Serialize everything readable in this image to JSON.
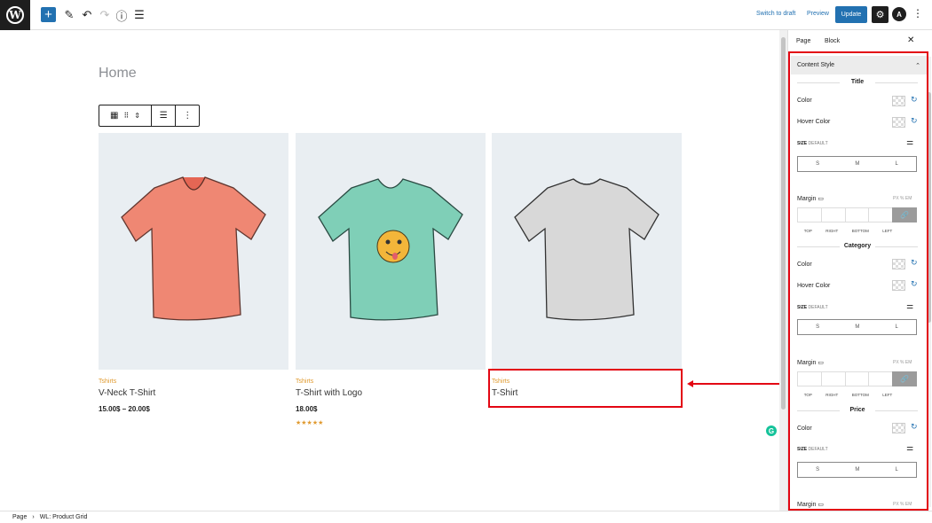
{
  "toolbar": {
    "switch_to_draft": "Switch to draft",
    "preview": "Preview",
    "update": "Update",
    "add_icon": "+",
    "edit_icon": "✎",
    "undo_icon": "↶",
    "redo_icon": "↷",
    "info_icon": "ⓘ",
    "list_icon": "☰",
    "settings_icon": "⚙",
    "more_icon": "⋮",
    "astra_icon": "A",
    "wp_icon": "W"
  },
  "canvas": {
    "page_title": "Home",
    "products": [
      {
        "category": "Tshirts",
        "name": "V-Neck T-Shirt",
        "price": "15.00$ – 20.00$",
        "color": "#f0826d"
      },
      {
        "category": "Tshirts",
        "name": "T-Shirt with Logo",
        "price": "18.00$",
        "stars": "★★★★★",
        "color": "#7fcfb7"
      },
      {
        "category": "Tshirts",
        "name": "T-Shirt",
        "price": "",
        "color": "#d8d8d8"
      }
    ],
    "grammarly_icon": "G"
  },
  "sidebar": {
    "tab_page": "Page",
    "tab_block": "Block",
    "close_icon": "✕",
    "panel_title": "Content Style",
    "panel_chevron": "⌃",
    "sections": [
      {
        "title": "Title",
        "color": "Color",
        "hover_color": "Hover Color"
      },
      {
        "title": "Category",
        "color": "Color",
        "hover_color": "Hover Color"
      },
      {
        "title": "Price",
        "color": "Color"
      }
    ],
    "size_label": "SIZE",
    "size_default": "DEFAULT",
    "size_options": [
      "S",
      "M",
      "L"
    ],
    "margin_label": "Margin",
    "margin_units": "PX % EM",
    "margin_sides": [
      "TOP",
      "RIGHT",
      "BOTTOM",
      "LEFT"
    ],
    "reset_icon": "↻",
    "sliders_icon": "⚌",
    "link_icon": "🔗",
    "desktop_icon": "▭"
  },
  "footer": {
    "crumb_page": "Page",
    "separator": "›",
    "crumb_block": "WL: Product Grid"
  }
}
